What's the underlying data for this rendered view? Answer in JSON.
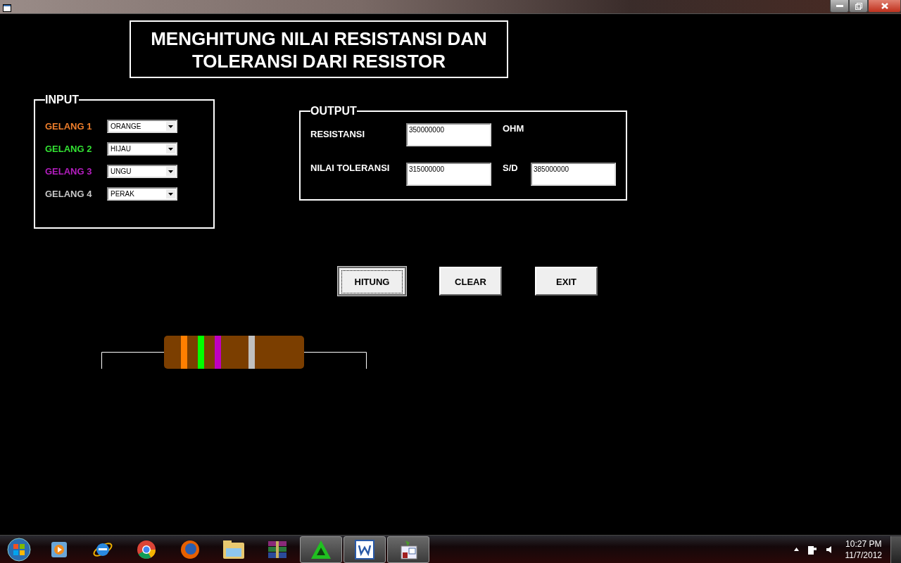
{
  "title": "MENGHITUNG NILAI RESISTANSI DAN TOLERANSI DARI RESISTOR",
  "input": {
    "legend": "INPUT",
    "bands": [
      {
        "label": "GELANG 1",
        "value": "ORANGE",
        "color": "#f07f2c"
      },
      {
        "label": "GELANG 2",
        "value": "HIJAU",
        "color": "#33e233"
      },
      {
        "label": "GELANG 3",
        "value": "UNGU",
        "color": "#b51ec0"
      },
      {
        "label": "GELANG 4",
        "value": "PERAK",
        "color": "#c8c8c8"
      }
    ]
  },
  "output": {
    "legend": "OUTPUT",
    "resistance_label": "RESISTANSI",
    "resistance": "350000000",
    "unit": "OHM",
    "tolerance_label": "NILAI TOLERANSI",
    "tolerance_min": "315000000",
    "range_label": "S/D",
    "tolerance_max": "385000000"
  },
  "buttons": [
    {
      "label": "HITUNG",
      "focused": true
    },
    {
      "label": "CLEAR",
      "focused": false
    },
    {
      "label": "EXIT",
      "focused": false
    }
  ],
  "resistor": {
    "bands": [
      {
        "color": "#ff7f00"
      },
      {
        "color": "#00ff00"
      },
      {
        "color": "#c000c0"
      },
      {
        "color": "#c0c0c0"
      }
    ]
  },
  "taskbar": {
    "apps": [
      {
        "kind": "media",
        "running": false
      },
      {
        "kind": "ie",
        "running": false
      },
      {
        "kind": "chrome",
        "running": false
      },
      {
        "kind": "firefox",
        "running": false
      },
      {
        "kind": "folder",
        "running": false
      },
      {
        "kind": "archive",
        "running": false
      },
      {
        "kind": "triangle",
        "running": true
      },
      {
        "kind": "word",
        "running": true
      },
      {
        "kind": "calc",
        "running": true
      }
    ],
    "time": "10:27 PM",
    "date": "11/7/2012"
  }
}
